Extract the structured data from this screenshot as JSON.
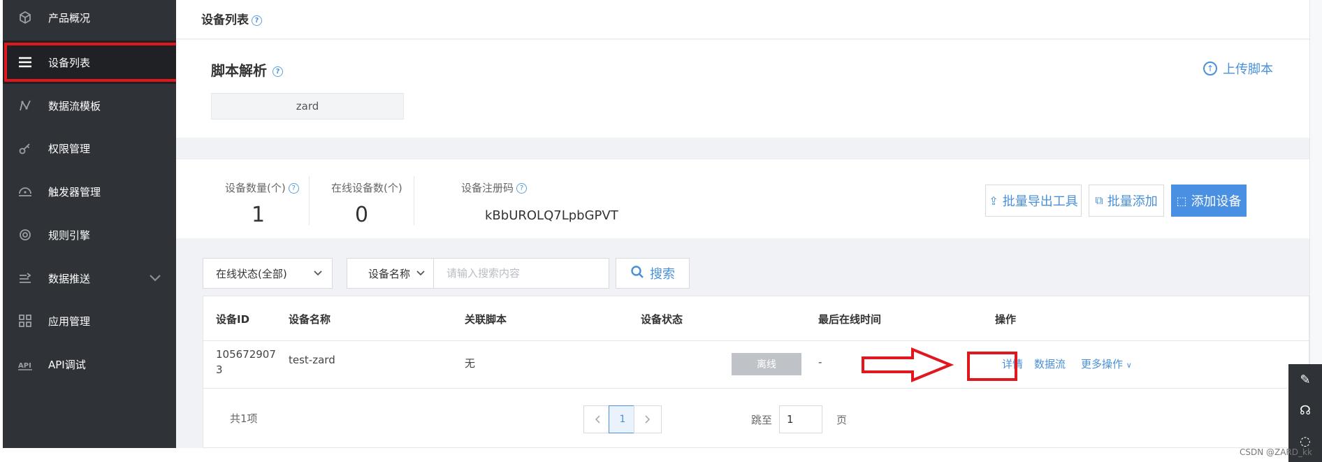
{
  "sidebar": {
    "items": [
      {
        "label": "产品概况",
        "icon": "cube-icon"
      },
      {
        "label": "设备列表",
        "icon": "menu-icon"
      },
      {
        "label": "数据流模板",
        "icon": "line-chart-icon"
      },
      {
        "label": "权限管理",
        "icon": "key-icon"
      },
      {
        "label": "触发器管理",
        "icon": "trigger-icon"
      },
      {
        "label": "规则引擎",
        "icon": "target-icon"
      },
      {
        "label": "数据推送",
        "icon": "push-icon"
      },
      {
        "label": "应用管理",
        "icon": "grid-icon"
      },
      {
        "label": "API调试",
        "icon": "api-icon"
      }
    ],
    "active_index": 1
  },
  "header": {
    "title": "设备列表"
  },
  "script": {
    "title": "脚本解析",
    "name": "zard",
    "upload_label": "上传脚本"
  },
  "stats": {
    "device_count_label": "设备数量(个)",
    "device_count": "1",
    "online_count_label": "在线设备数(个)",
    "online_count": "0",
    "reg_code_label": "设备注册码",
    "reg_code": "kBbUROLQ7LpbGPVT"
  },
  "actions": {
    "export_label": "批量导出工具",
    "batch_add_label": "批量添加",
    "add_device_label": "添加设备"
  },
  "filter": {
    "status_value": "在线状态(全部)",
    "field_value": "设备名称",
    "search_placeholder": "请输入搜索内容",
    "search_label": "搜索"
  },
  "table": {
    "columns": [
      "设备ID",
      "设备名称",
      "关联脚本",
      "设备状态",
      "最后在线时间",
      "操作"
    ],
    "rows": [
      {
        "id_line1": "105672907",
        "id_line2": "3",
        "name": "test-zard",
        "script": "无",
        "status": "离线",
        "last_online": "-",
        "op_detail": "详情",
        "op_stream": "数据流",
        "op_more": "更多操作"
      }
    ]
  },
  "pagination": {
    "total": "共1项",
    "current_page": "1",
    "jump_label": "跳至",
    "jump_value": "1",
    "page_suffix": "页"
  },
  "watermark": "CSDN @ZARD_kk",
  "colors": {
    "sidebar_bg": "#2f3237",
    "primary": "#4a90e2",
    "highlight": "#e0181e",
    "offline": "#bfc3c8"
  }
}
